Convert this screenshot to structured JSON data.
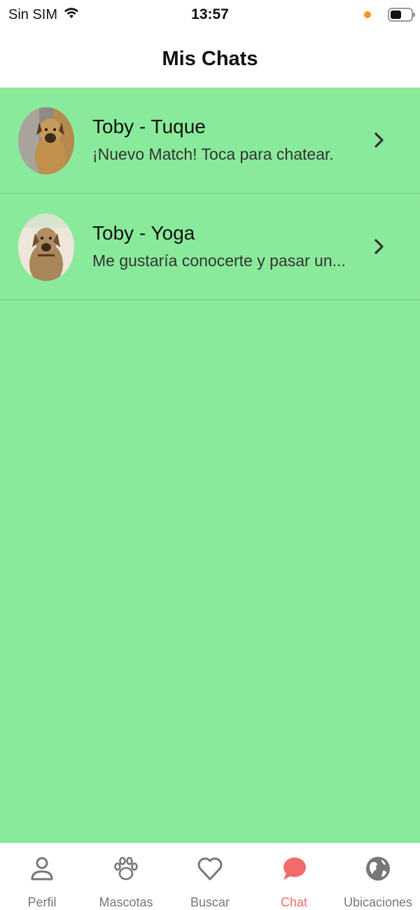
{
  "status_bar": {
    "carrier": "Sin SIM",
    "time": "13:57",
    "indicator_color": "#f7941d"
  },
  "header": {
    "title": "Mis Chats"
  },
  "theme": {
    "content_background": "#8aea9b",
    "active_tab_color": "#f26b6b",
    "inactive_tab_color": "#777777"
  },
  "chats": [
    {
      "name": "Toby - Tuque",
      "preview": "¡Nuevo Match! Toca para chatear.",
      "avatar": "dog-photo"
    },
    {
      "name": "Toby - Yoga",
      "preview": "Me gustaría conocerte y pasar un...",
      "avatar": "dog-photo"
    }
  ],
  "tabs": [
    {
      "label": "Perfil",
      "icon": "person-icon",
      "active": false
    },
    {
      "label": "Mascotas",
      "icon": "paw-icon",
      "active": false
    },
    {
      "label": "Buscar",
      "icon": "heart-icon",
      "active": false
    },
    {
      "label": "Chat",
      "icon": "chat-bubble-icon",
      "active": true
    },
    {
      "label": "Ubicaciones",
      "icon": "globe-icon",
      "active": false
    }
  ]
}
